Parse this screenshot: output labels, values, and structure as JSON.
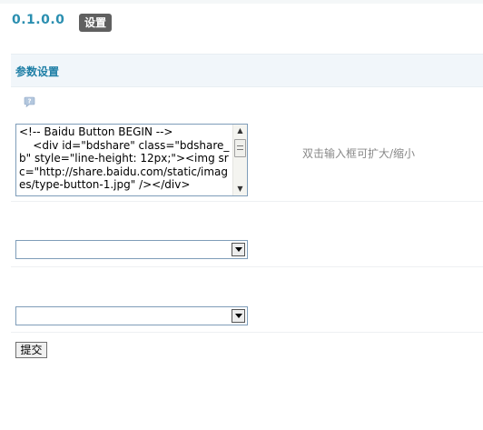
{
  "header": {
    "version": "0.1.0.0",
    "settings_badge": "设置"
  },
  "section": {
    "title": "参数设置"
  },
  "code_field": {
    "value": "<!-- Baidu Button BEGIN -->\n    <div id=\"bdshare\" class=\"bdshare_b\" style=\"line-height: 12px;\"><img src=\"http://share.baidu.com/static/images/type-button-1.jpg\" /></div>",
    "tip": "双击输入框可扩大/缩小"
  },
  "select_1": {
    "value": ""
  },
  "select_2": {
    "value": ""
  },
  "submit_label": "提交",
  "icons": {
    "help": "help-icon",
    "dropdown": "chevron-down-icon"
  }
}
